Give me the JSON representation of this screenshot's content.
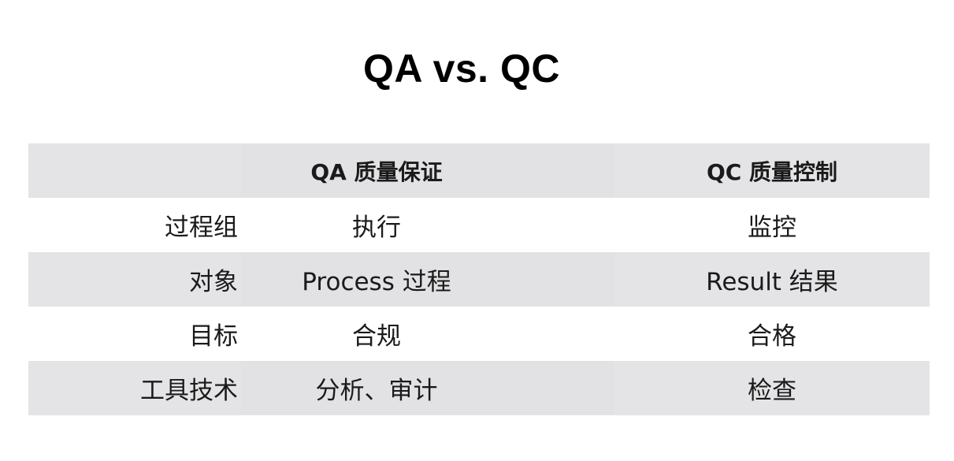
{
  "title": "QA vs. QC",
  "table": {
    "header": {
      "label": "",
      "qa": "QA 质量保证",
      "qc": "QC 质量控制"
    },
    "rows": [
      {
        "label": "过程组",
        "qa": "执行",
        "qc": "监控"
      },
      {
        "label": "对象",
        "qa": "Process 过程",
        "qc": "Result 结果"
      },
      {
        "label": "目标",
        "qa": "合规",
        "qc": "合格"
      },
      {
        "label": "工具技术",
        "qa": "分析、审计",
        "qc": "检查"
      }
    ]
  },
  "colors": {
    "shaded_row": "#e2e2e4",
    "text": "#1a1a1a",
    "background": "#ffffff"
  }
}
